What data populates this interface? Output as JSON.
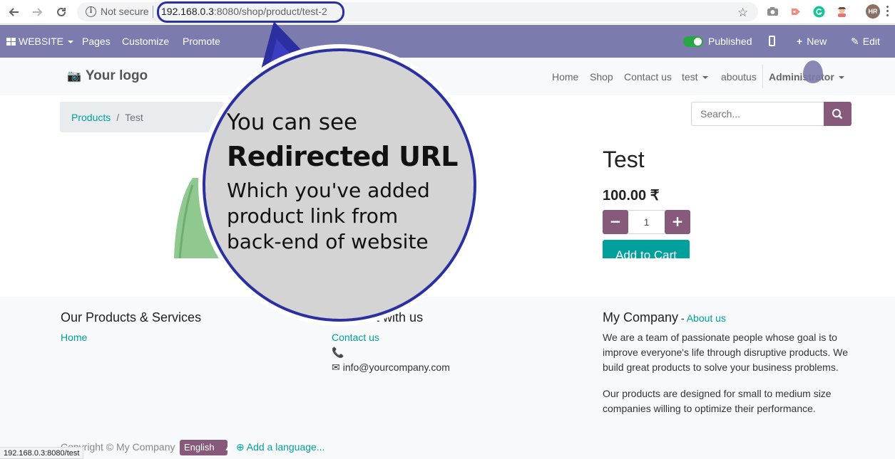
{
  "browser": {
    "security_label": "Not secure",
    "url_host": "192.168.0.3",
    "url_path": ":8080/shop/product/test-2",
    "profile_initials": "HR",
    "status_url": "192.168.0.3:8080/test"
  },
  "odoo_bar": {
    "website_label": "WEBSITE",
    "pages_label": "Pages",
    "customize_label": "Customize",
    "promote_label": "Promote",
    "published_label": "Published",
    "published": true,
    "new_label": "New",
    "edit_label": "Edit"
  },
  "site_header": {
    "logo_text": "Your logo",
    "menu": [
      "Home",
      "Shop",
      "Contact us",
      "test",
      "aboutus"
    ],
    "user_label": "Administrator"
  },
  "breadcrumb": {
    "parent": "Products",
    "current": "Test"
  },
  "search": {
    "placeholder": "Search..."
  },
  "product": {
    "name": "Test",
    "price": "100.00 ₹",
    "quantity": "1",
    "add_to_cart_label": "Add to Cart"
  },
  "footer": {
    "col1_title": "Our Products & Services",
    "col1_link": "Home",
    "col2_title": "Connect with us",
    "col2_link": "Contact us",
    "email": "info@yourcompany.com",
    "col3_title": "My Company",
    "col3_dash": " - ",
    "col3_link": "About us",
    "about_p1": "We are a team of passionate people whose goal is to improve everyone's life through disruptive products. We build great products to solve your business problems.",
    "about_p2": "Our products are designed for small to medium size companies willing to optimize their performance.",
    "copyright": "Copyright © My Company",
    "language": "English",
    "add_language": "Add a language..."
  },
  "callout": {
    "line1": "You can see",
    "line2": "Redirected URL",
    "line3": "Which you've added product link from back-end of website"
  },
  "colors": {
    "odoo_bar": "#7c7bad",
    "brand_purple": "#875a7b",
    "link_teal": "#00a09d",
    "callout_border": "#2c2fa0",
    "callout_fill": "#d4d4d4"
  }
}
